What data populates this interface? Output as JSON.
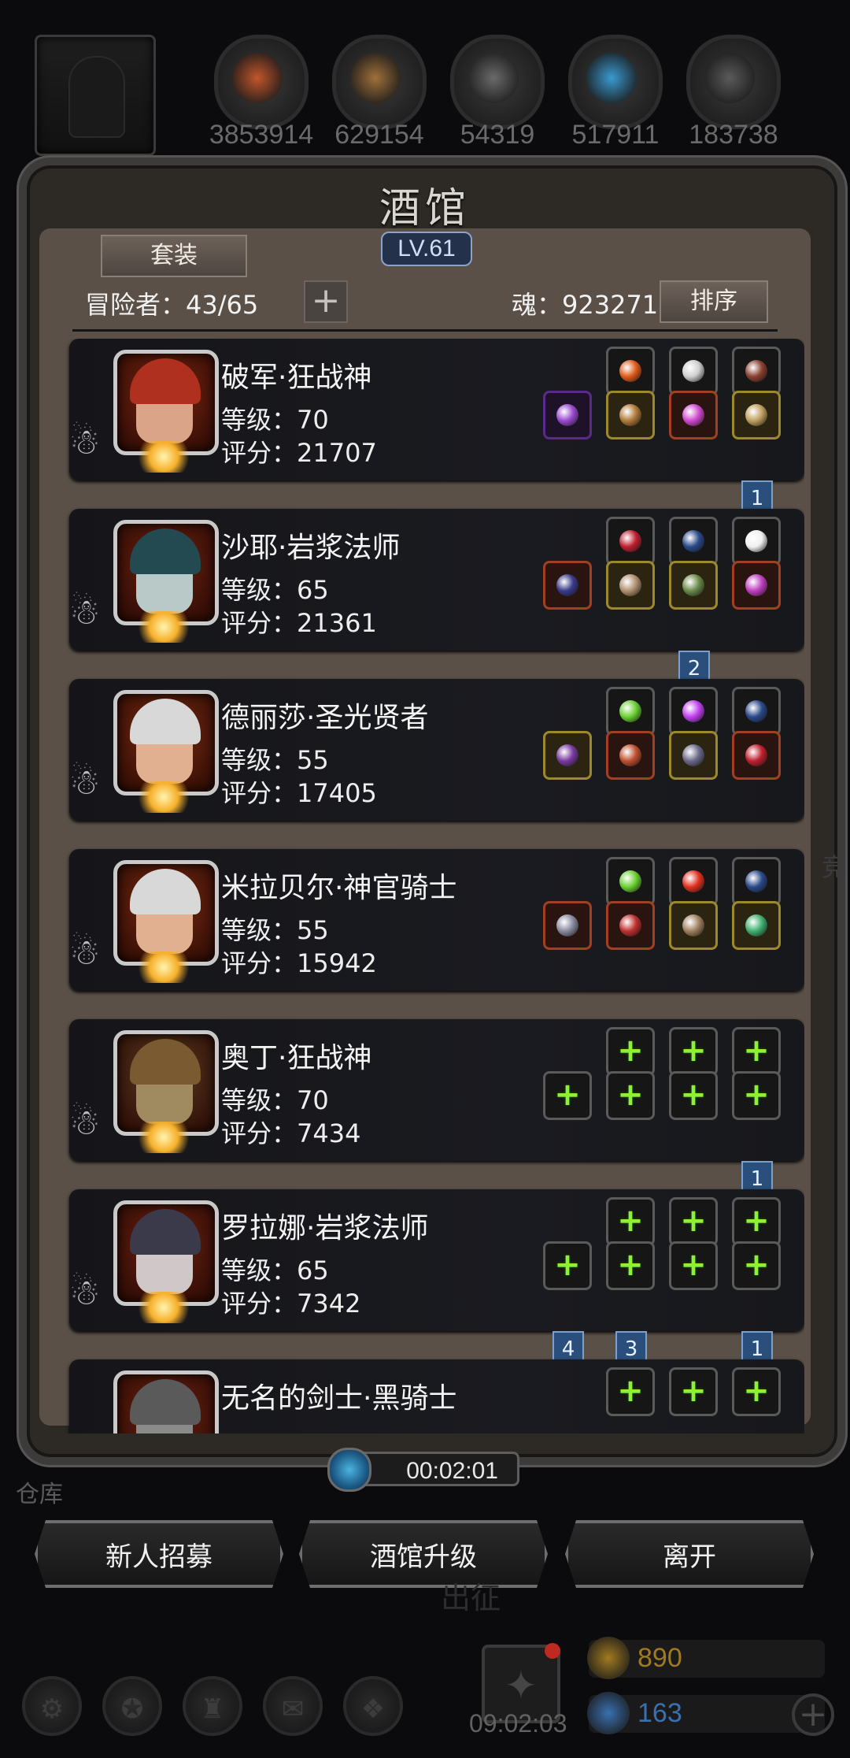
{
  "resources": [
    {
      "icon": "ore-icon",
      "value": "3853914",
      "color": "#c2562a"
    },
    {
      "icon": "wood-icon",
      "value": "629154",
      "color": "#a0703a"
    },
    {
      "icon": "iron-icon",
      "value": "54319",
      "color": "#6a6a6a"
    },
    {
      "icon": "crystal-icon",
      "value": "517911",
      "color": "#3a9ad0"
    },
    {
      "icon": "steel-icon",
      "value": "183738",
      "color": "#5a5a5a"
    }
  ],
  "panel": {
    "title": "酒馆",
    "level": "LV.61",
    "set_button": "套装",
    "adventurer_label": "冒险者：43/65",
    "add_label": "+",
    "soul_label": "魂：923271",
    "sort_button": "排序"
  },
  "heroes": [
    {
      "name": "破军·狂战神",
      "level": "等级：70",
      "score": "评分：21707",
      "avatar_bg": "#7a2410",
      "hair": "#b03020",
      "face": "#d9a488",
      "top_slots": [
        {
          "t": "gem",
          "c": "#e05a1a",
          "b": ""
        },
        {
          "t": "gem",
          "c": "#cfcfcf",
          "b": ""
        },
        {
          "t": "gem",
          "c": "#8a4030",
          "b": ""
        }
      ],
      "bottom_slots": [
        {
          "t": "gem",
          "c": "#9a4ad0",
          "b": "purple"
        },
        {
          "t": "gem",
          "c": "#b07a3a",
          "b": "gold"
        },
        {
          "t": "gem",
          "c": "#d04ad0",
          "b": "red"
        },
        {
          "t": "gem",
          "c": "#c0a060",
          "b": "gold"
        }
      ],
      "badges": [
        {
          "text": "1",
          "slot": 3
        }
      ]
    },
    {
      "name": "沙耶·岩浆法师",
      "level": "等级：65",
      "score": "评分：21361",
      "avatar_bg": "#6a2010",
      "hair": "#234a50",
      "face": "#b9c9c8",
      "top_slots": [
        {
          "t": "gem",
          "c": "#c02030",
          "b": ""
        },
        {
          "t": "gem",
          "c": "#2a4a8a",
          "b": ""
        },
        {
          "t": "gem",
          "c": "#f0f0f0",
          "b": ""
        }
      ],
      "bottom_slots": [
        {
          "t": "gem",
          "c": "#3a3a8a",
          "b": "red"
        },
        {
          "t": "gem",
          "c": "#b09070",
          "b": "gold"
        },
        {
          "t": "gem",
          "c": "#6a8a4a",
          "b": "gold"
        },
        {
          "t": "gem",
          "c": "#c040c0",
          "b": "red"
        }
      ],
      "badges": [
        {
          "text": "2",
          "slot": 2
        }
      ]
    },
    {
      "name": "德丽莎·圣光贤者",
      "level": "等级：55",
      "score": "评分：17405",
      "avatar_bg": "#7a2a10",
      "hair": "#d8d8d8",
      "face": "#e0b090",
      "top_slots": [
        {
          "t": "gem",
          "c": "#6ad030",
          "b": ""
        },
        {
          "t": "gem",
          "c": "#c040f0",
          "b": ""
        },
        {
          "t": "gem",
          "c": "#2a4a8a",
          "b": ""
        }
      ],
      "bottom_slots": [
        {
          "t": "gem",
          "c": "#7a3aa0",
          "b": "gold"
        },
        {
          "t": "gem",
          "c": "#c05030",
          "b": "red"
        },
        {
          "t": "gem",
          "c": "#6a6a8a",
          "b": "gold"
        },
        {
          "t": "gem",
          "c": "#c02030",
          "b": "red"
        }
      ],
      "badges": []
    },
    {
      "name": "米拉贝尔·神官骑士",
      "level": "等级：55",
      "score": "评分：15942",
      "avatar_bg": "#7a2a10",
      "hair": "#d8d8d8",
      "face": "#e0b090",
      "top_slots": [
        {
          "t": "gem",
          "c": "#6ad030",
          "b": ""
        },
        {
          "t": "gem",
          "c": "#e03020",
          "b": ""
        },
        {
          "t": "gem",
          "c": "#2a4a8a",
          "b": ""
        }
      ],
      "bottom_slots": [
        {
          "t": "gem",
          "c": "#8a8aa0",
          "b": "red"
        },
        {
          "t": "gem",
          "c": "#c03030",
          "b": "red"
        },
        {
          "t": "gem",
          "c": "#a08060",
          "b": "gold"
        },
        {
          "t": "gem",
          "c": "#40b070",
          "b": "gold"
        }
      ],
      "badges": []
    },
    {
      "name": "奥丁·狂战神",
      "level": "等级：70",
      "score": "评分：7434",
      "avatar_bg": "#5a3a20",
      "hair": "#7a5a30",
      "face": "#a08a60",
      "top_slots": [
        {
          "t": "plus"
        },
        {
          "t": "plus"
        },
        {
          "t": "plus"
        }
      ],
      "bottom_slots": [
        {
          "t": "plus"
        },
        {
          "t": "plus"
        },
        {
          "t": "plus"
        },
        {
          "t": "plus"
        }
      ],
      "badges": [
        {
          "text": "1",
          "slot": 3
        }
      ]
    },
    {
      "name": "罗拉娜·岩浆法师",
      "level": "等级：65",
      "score": "评分：7342",
      "avatar_bg": "#6a2010",
      "hair": "#3a3a4a",
      "face": "#d0c8c8",
      "top_slots": [
        {
          "t": "plus"
        },
        {
          "t": "plus"
        },
        {
          "t": "plus"
        }
      ],
      "bottom_slots": [
        {
          "t": "plus"
        },
        {
          "t": "plus"
        },
        {
          "t": "plus"
        },
        {
          "t": "plus"
        }
      ],
      "badges": [
        {
          "text": "4",
          "slot": 0
        },
        {
          "text": "3",
          "slot": 1
        },
        {
          "text": "1",
          "slot": 3
        }
      ]
    },
    {
      "name": "无名的剑士·黑骑士",
      "level": "",
      "score": "",
      "avatar_bg": "#6a2010",
      "hair": "#5a5a5a",
      "face": "#8a8a8a",
      "top_slots": [
        {
          "t": "plus"
        },
        {
          "t": "plus"
        },
        {
          "t": "plus"
        }
      ],
      "bottom_slots": [],
      "badges": []
    }
  ],
  "timer": "00:02:01",
  "warehouse_label": "仓库",
  "buttons": {
    "recruit": "新人招募",
    "upgrade": "酒馆升级",
    "leave": "离开"
  },
  "background_label": "出征",
  "side_label": "竞",
  "gift_timer": "09:02:03",
  "currency": [
    {
      "icon": "gold-ingot-icon",
      "value": "890",
      "color": "#a07a20"
    },
    {
      "icon": "diamond-icon",
      "value": "163",
      "color": "#3a70b0"
    }
  ]
}
